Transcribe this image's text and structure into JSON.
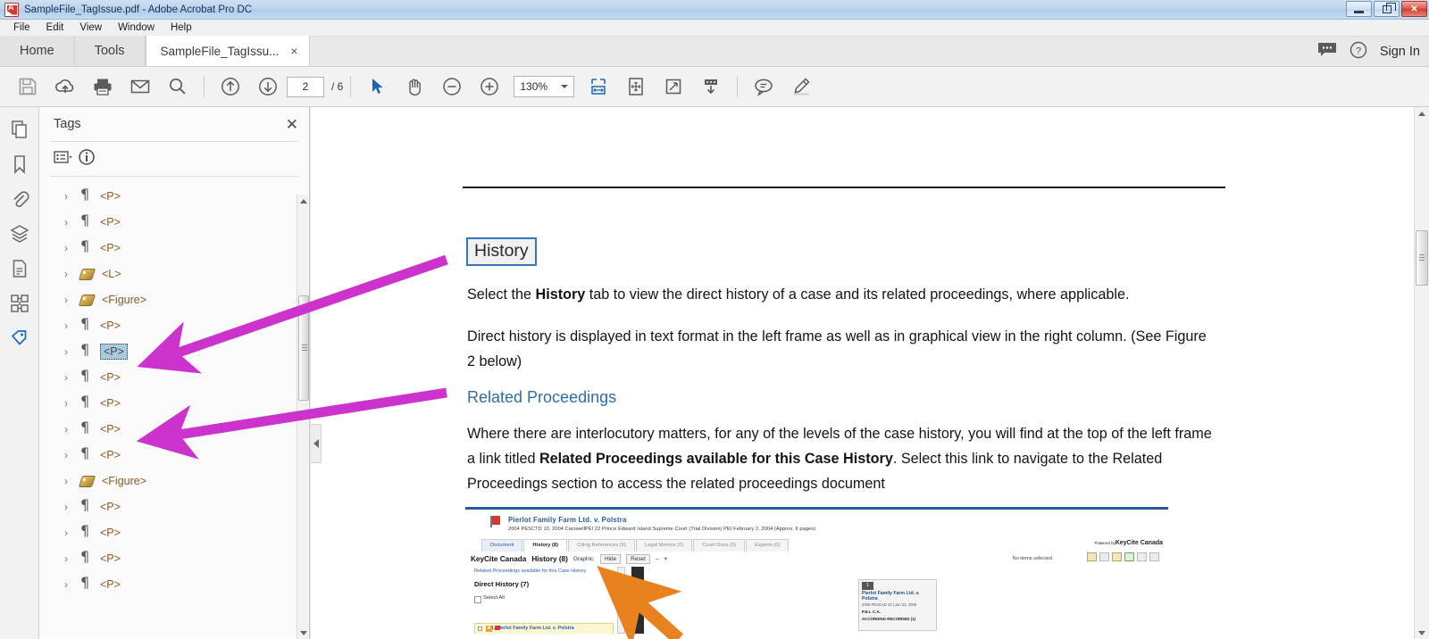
{
  "window": {
    "title": "SampleFile_TagIssue.pdf - Adobe Acrobat Pro DC",
    "minimize_label": "Minimize",
    "maximize_label": "Restore",
    "close_label": "Close"
  },
  "menubar": {
    "items": [
      "File",
      "Edit",
      "View",
      "Window",
      "Help"
    ]
  },
  "tabstrip": {
    "home": "Home",
    "tools": "Tools",
    "document_tab": "SampleFile_TagIssu...",
    "close_tab": "×",
    "sign_in": "Sign In",
    "comment_icon": "comment-icon",
    "help_icon": "help-icon"
  },
  "toolbar": {
    "save_icon": "save-icon",
    "upload_icon": "upload-cloud-icon",
    "print_icon": "print-icon",
    "email_icon": "email-icon",
    "search_icon": "search-icon",
    "prev_page_icon": "arrow-up-circle-icon",
    "next_page_icon": "arrow-down-circle-icon",
    "page_number": "2",
    "page_total": "/ 6",
    "select_icon": "cursor-select-icon",
    "hand_icon": "hand-tool-icon",
    "zoom_out_icon": "zoom-out-icon",
    "zoom_in_icon": "zoom-in-icon",
    "zoom_value": "130%",
    "fit_width_icon": "fit-width-icon",
    "fit_page_icon": "fit-page-icon",
    "fullscreen_icon": "fullscreen-icon",
    "scroll_mode_icon": "scroll-mode-icon",
    "comment_icon": "comment-bubble-icon",
    "highlight_icon": "highlighter-icon"
  },
  "rail": {
    "items": [
      {
        "name": "page-thumbnails-icon",
        "active": false
      },
      {
        "name": "bookmarks-icon",
        "active": false
      },
      {
        "name": "attachments-icon",
        "active": false
      },
      {
        "name": "layers-icon",
        "active": false
      },
      {
        "name": "document-icon",
        "active": false
      },
      {
        "name": "content-order-icon",
        "active": false
      },
      {
        "name": "tags-icon",
        "active": true
      }
    ]
  },
  "tags_panel": {
    "title": "Tags",
    "close_label": "✕",
    "options_icon": "options-list-icon",
    "info_icon": "info-icon",
    "tree": [
      {
        "label": "<P>",
        "icon": "paragraph",
        "selected": false
      },
      {
        "label": "<P>",
        "icon": "paragraph",
        "selected": false
      },
      {
        "label": "<P>",
        "icon": "paragraph",
        "selected": false
      },
      {
        "label": "<L>",
        "icon": "tag",
        "selected": false
      },
      {
        "label": "<Figure>",
        "icon": "tag",
        "selected": false
      },
      {
        "label": "<P>",
        "icon": "paragraph",
        "selected": false
      },
      {
        "label": "<P>",
        "icon": "paragraph",
        "selected": true
      },
      {
        "label": "<P>",
        "icon": "paragraph",
        "selected": false
      },
      {
        "label": "<P>",
        "icon": "paragraph",
        "selected": false
      },
      {
        "label": "<P>",
        "icon": "paragraph",
        "selected": false
      },
      {
        "label": "<P>",
        "icon": "paragraph",
        "selected": false
      },
      {
        "label": "<Figure>",
        "icon": "tag",
        "selected": false
      },
      {
        "label": "<P>",
        "icon": "paragraph",
        "selected": false
      },
      {
        "label": "<P>",
        "icon": "paragraph",
        "selected": false
      },
      {
        "label": "<P>",
        "icon": "paragraph",
        "selected": false
      },
      {
        "label": "<P>",
        "icon": "paragraph",
        "selected": false
      }
    ]
  },
  "document": {
    "heading": "History",
    "paragraph_1_pre": "Select the ",
    "paragraph_1_bold": "History",
    "paragraph_1_post": " tab to view the direct history of a case and its related proceedings, where applicable.",
    "paragraph_2": "Direct history is displayed in text format in the left frame as well as in graphical view in the right column. (See Figure 2 below)",
    "subheading": "Related Proceedings",
    "paragraph_3_pre": "Where there are interlocutory matters, for any of the levels of the case history, you will find at the top of the left frame a link titled ",
    "paragraph_3_bold": "Related Proceedings available for this Case History",
    "paragraph_3_post": ". Select this link to navigate to the Related Proceedings section to access the related proceedings document",
    "figure": {
      "case_title": "Pierlot Family Farm Ltd. v. Polstra",
      "case_meta": "2004 PESCTD 10, 2004 CarswellPEI 22    Prince Edward Island Supreme Court (Trial Division)    PEI    February 2, 2004   (Approx. 6 pages)",
      "tabs": [
        "Document",
        "History (8)",
        "Citing References (6)",
        "Legal Memos (0)",
        "Court Docs (0)",
        "Experts (0)"
      ],
      "powered_by": "Powered by",
      "brand": "KeyCite Canada",
      "bar_brand": "KeyCite Canada",
      "bar_history": "History (8)",
      "bar_graphic": "Graphic:",
      "btn_hide": "Hide",
      "btn_reset": "Reset",
      "no_items": "No items selected",
      "related_link": "Related Proceedings available for this Case History",
      "direct_history": "Direct History (7)",
      "select_all": "Select All",
      "list_item_1": "1. Pierlot Family Farm Ltd. v. Polstra",
      "node_title": "Pierlot Family Farm Ltd. v. Polstra",
      "node_meta": "2008 PESCAD 10  |  Jun 23, 2008",
      "node_court": "P.E.I. C.A.",
      "node_foot": "ACCORDING RECORDED (1)"
    }
  },
  "colors": {
    "accent_blue": "#3777b8",
    "link_blue": "#2f6ea5",
    "tag_gold": "#8b5a2b",
    "arrow_magenta": "#cc33cc",
    "arrow_orange": "#e8821e",
    "selection_blue": "#a8cbe2"
  }
}
